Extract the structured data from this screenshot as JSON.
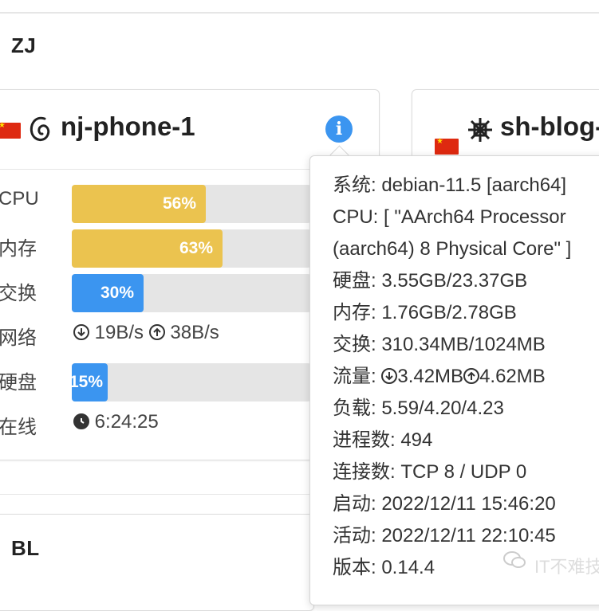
{
  "groups": {
    "zj_title": "ZJ",
    "bl_title": "BL"
  },
  "card1": {
    "name": "nj-phone-1",
    "os_icon": "debian-swirl-icon",
    "flag": "china-flag-icon",
    "info_button": "i",
    "metrics": {
      "cpu_label": "CPU",
      "cpu_value": "56%",
      "cpu_fraction": 0.56,
      "mem_label": "内存",
      "mem_value": "63%",
      "mem_fraction": 0.63,
      "swap_label": "交换",
      "swap_value": "30%",
      "swap_fraction": 0.3,
      "net_label": "网络",
      "net_down": "19B/s",
      "net_up": "38B/s",
      "disk_label": "硬盘",
      "disk_value": "15%",
      "disk_fraction": 0.15,
      "uptime_label": "在线",
      "uptime_value": "6:24:25"
    },
    "colors": {
      "warn_bar": "#ebc34f",
      "ok_bar": "#3b95f0"
    }
  },
  "card2": {
    "name": "sh-blog-",
    "os_icon": "centos-snowflake-icon",
    "flag": "china-flag-icon"
  },
  "tooltip": {
    "lines": [
      "系统: debian-11.5 [aarch64]",
      "CPU: [ \"AArch64 Processor",
      "(aarch64) 8 Physical Core\" ]",
      "硬盘: 3.55GB/23.37GB",
      "内存: 1.76GB/2.78GB",
      "交换: 310.34MB/1024MB",
      "负载: 5.59/4.20/4.23",
      "进程数: 494",
      "连接数: TCP 8 / UDP 0",
      "启动: 2022/12/11 15:46:20",
      "活动: 2022/12/11 22:10:45",
      "版本: 0.14.4"
    ],
    "traffic_label": "流量: ",
    "traffic_down": "3.42MB",
    "traffic_up": "4.62MB"
  },
  "watermark": {
    "text": "IT不难技"
  }
}
